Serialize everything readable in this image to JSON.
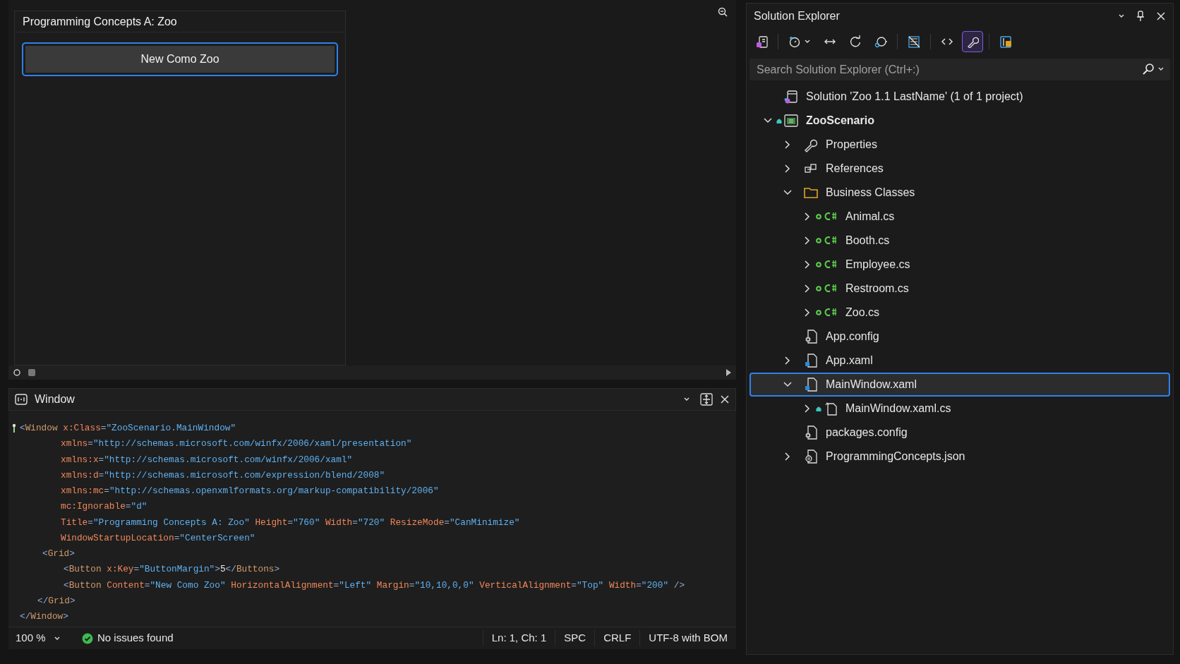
{
  "designer": {
    "form_title": "Programming Concepts A: Zoo",
    "button": {
      "label": "New Como Zoo",
      "focused": true
    }
  },
  "editor": {
    "title": "Window",
    "lines": [
      {
        "kind": "root",
        "tokens": [
          {
            "kind": "punct",
            "text": "<"
          },
          {
            "kind": "tag",
            "text": "Window"
          },
          {
            "kind": "attr",
            "text": " x:Class"
          },
          {
            "kind": "punct",
            "text": "="
          },
          {
            "kind": "value",
            "text": "\"ZooScenario.MainWindow\""
          }
        ]
      },
      {
        "kind": "continuation",
        "tokens": [
          {
            "kind": "attr",
            "text": "xmlns"
          },
          {
            "kind": "punct",
            "text": "="
          },
          {
            "kind": "value",
            "text": "\"http://schemas.microsoft.com/winfx/2006/xaml/presentation\""
          }
        ]
      },
      {
        "kind": "continuation",
        "tokens": [
          {
            "kind": "attr",
            "text": "xmlns:x"
          },
          {
            "kind": "punct",
            "text": "="
          },
          {
            "kind": "value",
            "text": "\"http://schemas.microsoft.com/winfx/2006/xaml\""
          }
        ]
      },
      {
        "kind": "continuation",
        "tokens": [
          {
            "kind": "attr",
            "text": "xmlns:d"
          },
          {
            "kind": "punct",
            "text": "="
          },
          {
            "kind": "value",
            "text": "\"http://schemas.microsoft.com/expression/blend/2008\""
          }
        ]
      },
      {
        "kind": "continuation",
        "tokens": [
          {
            "kind": "attr",
            "text": "xmlns:mc"
          },
          {
            "kind": "punct",
            "text": "="
          },
          {
            "kind": "value",
            "text": "\"http://schemas.openxmlformats.org/markup-compatibility/2006\""
          }
        ]
      },
      {
        "kind": "continuation",
        "tokens": [
          {
            "kind": "attr",
            "text": "mc:Ignorable"
          },
          {
            "kind": "punct",
            "text": "="
          },
          {
            "kind": "value",
            "text": "\"d\""
          }
        ]
      },
      {
        "kind": "continuation",
        "tokens": [
          {
            "kind": "attr",
            "text": "Title"
          },
          {
            "kind": "punct",
            "text": "="
          },
          {
            "kind": "value",
            "text": "\"Programming Concepts A: Zoo\""
          },
          {
            "kind": "attr",
            "text": " Height"
          },
          {
            "kind": "punct",
            "text": "="
          },
          {
            "kind": "value",
            "text": "\"760\""
          },
          {
            "kind": "attr",
            "text": " Width"
          },
          {
            "kind": "punct",
            "text": "="
          },
          {
            "kind": "value",
            "text": "\"720\""
          },
          {
            "kind": "attr",
            "text": " ResizeMode"
          },
          {
            "kind": "punct",
            "text": "="
          },
          {
            "kind": "value",
            "text": "\"CanMinimize\""
          }
        ]
      },
      {
        "kind": "continuation",
        "tokens": [
          {
            "kind": "attr",
            "text": "WindowStartupLocation"
          },
          {
            "kind": "punct",
            "text": "="
          },
          {
            "kind": "value",
            "text": "\"CenterScreen\""
          }
        ]
      },
      {
        "kind": "child",
        "tokens": [
          {
            "kind": "punct",
            "text": "<"
          },
          {
            "kind": "tag",
            "text": "Grid"
          },
          {
            "kind": "punct",
            "text": ">"
          }
        ]
      },
      {
        "kind": "grandchild",
        "tokens": [
          {
            "kind": "punct",
            "text": "<"
          },
          {
            "kind": "tag",
            "text": "Button"
          },
          {
            "kind": "attr",
            "text": " x:Key"
          },
          {
            "kind": "punct",
            "text": "="
          },
          {
            "kind": "value",
            "text": "\"ButtonMargin\""
          },
          {
            "kind": "punct",
            "text": ">"
          },
          {
            "kind": "text",
            "text": "5"
          },
          {
            "kind": "punct",
            "text": "</"
          },
          {
            "kind": "tag",
            "text": "Buttons"
          },
          {
            "kind": "punct",
            "text": ">"
          }
        ]
      },
      {
        "kind": "grandchild",
        "tokens": [
          {
            "kind": "punct",
            "text": "<"
          },
          {
            "kind": "tag",
            "text": "Button"
          },
          {
            "kind": "attr",
            "text": " Content"
          },
          {
            "kind": "punct",
            "text": "="
          },
          {
            "kind": "value",
            "text": "\"New Como Zoo\""
          },
          {
            "kind": "attr",
            "text": " HorizontalAlignment"
          },
          {
            "kind": "punct",
            "text": "="
          },
          {
            "kind": "value",
            "text": "\"Left\""
          },
          {
            "kind": "attr",
            "text": " Margin"
          },
          {
            "kind": "punct",
            "text": "="
          },
          {
            "kind": "value",
            "text": "\"10,10,0,0\""
          },
          {
            "kind": "attr",
            "text": " VerticalAlignment"
          },
          {
            "kind": "punct",
            "text": "="
          },
          {
            "kind": "value",
            "text": "\"Top\""
          },
          {
            "kind": "attr",
            "text": " Width"
          },
          {
            "kind": "punct",
            "text": "="
          },
          {
            "kind": "value",
            "text": "\"200\""
          },
          {
            "kind": "punct",
            "text": " />"
          }
        ]
      },
      {
        "kind": "child-close",
        "tokens": [
          {
            "kind": "punct",
            "text": "</"
          },
          {
            "kind": "tag",
            "text": "Grid"
          },
          {
            "kind": "punct",
            "text": ">"
          }
        ]
      },
      {
        "kind": "root",
        "tokens": [
          {
            "kind": "punct",
            "text": "</"
          },
          {
            "kind": "tag",
            "text": "Window"
          },
          {
            "kind": "punct",
            "text": ">"
          }
        ]
      }
    ]
  },
  "status_bar": {
    "zoom": "100 %",
    "issues": "No issues found",
    "position": "Ln: 1, Ch: 1",
    "whitespace": "SPC",
    "line_ending": "CRLF",
    "encoding": "UTF-8 with BOM"
  },
  "solution_explorer": {
    "title": "Solution Explorer",
    "toolbar": [
      {
        "kind": "switch-views",
        "selected": false
      },
      {
        "kind": "history",
        "selected": false
      },
      {
        "kind": "sync",
        "selected": false
      },
      {
        "kind": "refresh",
        "selected": false
      },
      {
        "kind": "pending",
        "selected": false
      },
      {
        "kind": "collapse",
        "selected": false
      },
      {
        "kind": "code",
        "selected": false
      },
      {
        "kind": "properties",
        "selected": true
      },
      {
        "kind": "preview",
        "selected": false
      }
    ],
    "search": {
      "placeholder": "Search Solution Explorer (Ctrl+:)"
    },
    "tree": [
      {
        "label": "Solution 'Zoo 1.1 LastName' (1 of 1 project)",
        "kind": "solution",
        "added": false,
        "locked": false,
        "selected": false
      },
      {
        "label": "ZooScenario",
        "kind": "project",
        "expanded": true,
        "added": false,
        "locked": true,
        "selected": false,
        "children": [
          {
            "label": "Properties",
            "kind": "properties",
            "expanded": false,
            "added": false,
            "locked": false,
            "selected": false
          },
          {
            "label": "References",
            "kind": "references",
            "expanded": false,
            "added": false,
            "locked": false,
            "selected": false
          },
          {
            "label": "Business Classes",
            "kind": "folder",
            "expanded": true,
            "added": false,
            "locked": false,
            "selected": false,
            "children": [
              {
                "label": "Animal.cs",
                "kind": "csharp",
                "expanded": false,
                "added": true,
                "locked": false,
                "selected": false
              },
              {
                "label": "Booth.cs",
                "kind": "csharp",
                "expanded": false,
                "added": true,
                "locked": false,
                "selected": false
              },
              {
                "label": "Employee.cs",
                "kind": "csharp",
                "expanded": false,
                "added": true,
                "locked": false,
                "selected": false
              },
              {
                "label": "Restroom.cs",
                "kind": "csharp",
                "expanded": false,
                "added": true,
                "locked": false,
                "selected": false
              },
              {
                "label": "Zoo.cs",
                "kind": "csharp",
                "expanded": false,
                "added": true,
                "locked": false,
                "selected": false
              }
            ]
          },
          {
            "label": "App.config",
            "kind": "config",
            "added": false,
            "locked": false,
            "selected": false
          },
          {
            "label": "App.xaml",
            "kind": "xaml",
            "expanded": false,
            "added": false,
            "locked": false,
            "selected": false
          },
          {
            "label": "MainWindow.xaml",
            "kind": "xaml",
            "expanded": true,
            "added": false,
            "locked": false,
            "selected": true,
            "children": [
              {
                "label": "MainWindow.xaml.cs",
                "kind": "codefile",
                "expanded": false,
                "added": false,
                "locked": true,
                "selected": false
              }
            ]
          },
          {
            "label": "packages.config",
            "kind": "config",
            "added": false,
            "locked": false,
            "selected": false
          },
          {
            "label": "ProgrammingConcepts.json",
            "kind": "json",
            "expanded": false,
            "added": false,
            "locked": false,
            "selected": false
          }
        ]
      }
    ]
  }
}
